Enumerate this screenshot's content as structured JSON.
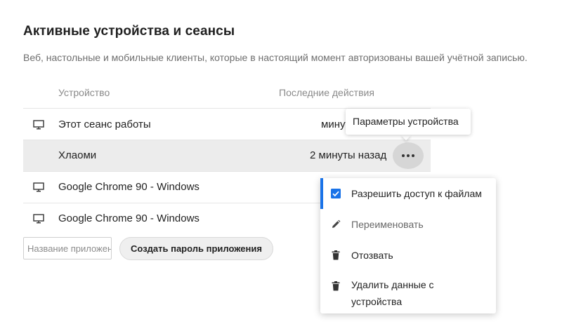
{
  "section": {
    "title": "Активные устройства и сеансы",
    "subtitle": "Веб, настольные и мобильные клиенты, которые в настоящий момент авторизованы вашей учётной записью."
  },
  "table": {
    "columns": [
      "Устройство",
      "Последние действия"
    ],
    "rows": [
      {
        "device": "Этот сеанс работы",
        "last_activity": "минут",
        "icon": "desktop-icon"
      },
      {
        "device": "Хлаоми",
        "last_activity": "2 минуты назад",
        "icon": ""
      },
      {
        "device": "Google Chrome 90 - Windows",
        "last_activity": "",
        "icon": "desktop-icon"
      },
      {
        "device": "Google Chrome 90 - Windows",
        "last_activity": "",
        "icon": "desktop-icon"
      }
    ]
  },
  "app_password": {
    "placeholder": "Название приложения",
    "create_label": "Создать пароль приложения"
  },
  "tooltip": {
    "text": "Параметры устройства"
  },
  "context_menu": {
    "items": [
      {
        "label": "Разрешить доступ к файлам",
        "icon": "checkbox-checked-icon"
      },
      {
        "label": "Переименовать",
        "icon": "pencil-icon"
      },
      {
        "label": "Отозвать",
        "icon": "trash-icon"
      },
      {
        "label": "Удалить данные с",
        "label_line2": "устройства",
        "icon": "trash-icon"
      }
    ]
  },
  "colors": {
    "accent": "#1a73e8",
    "selected_row": "#ececec",
    "more_button": "#d6d6d6"
  }
}
